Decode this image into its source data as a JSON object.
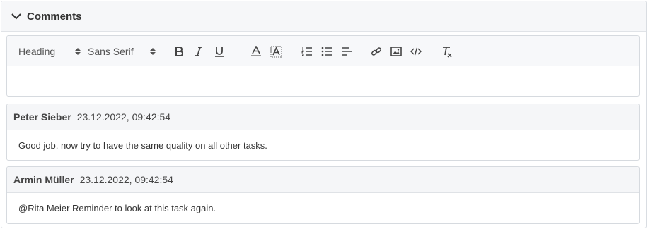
{
  "panel": {
    "title": "Comments",
    "collapse_icon": "chevron-down-icon"
  },
  "editor": {
    "heading_picker": "Heading",
    "font_picker": "Sans Serif",
    "toolbar_icons": [
      "bold-icon",
      "italic-icon",
      "underline-icon",
      "font-color-icon",
      "background-color-icon",
      "ordered-list-icon",
      "bullet-list-icon",
      "align-icon",
      "link-icon",
      "image-icon",
      "code-icon",
      "clear-format-icon"
    ],
    "content": ""
  },
  "comments": [
    {
      "author": "Peter Sieber",
      "timestamp": "23.12.2022, 09:42:54",
      "text": "Good job, now try to have the same quality on all other tasks."
    },
    {
      "author": "Armin Müller",
      "timestamp": "23.12.2022, 09:42:54",
      "text": "@Rita Meier Reminder to look at this task again."
    }
  ]
}
